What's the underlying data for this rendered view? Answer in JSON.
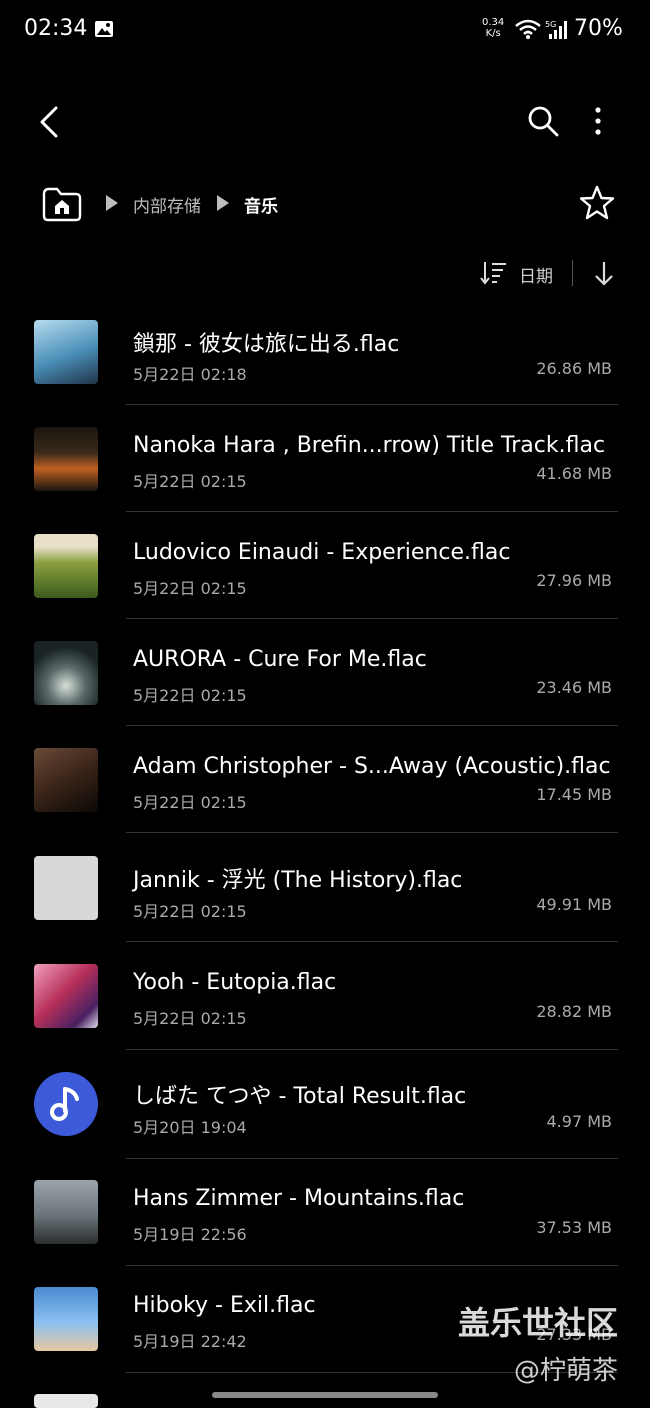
{
  "status_bar": {
    "time": "02:34",
    "net_speed_top": "0.34",
    "net_speed_bottom": "K/s",
    "signal_label": "5G",
    "battery": "70%"
  },
  "breadcrumb": {
    "items": [
      "内部存储",
      "音乐"
    ]
  },
  "sort": {
    "label": "日期"
  },
  "files": [
    {
      "name": "鎖那 - 彼女は旅に出る.flac",
      "date": "5月22日 02:18",
      "size": "26.86 MB",
      "thumb_color": "#4a8fb8"
    },
    {
      "name": "Nanoka Hara , Brefin...rrow) Title Track.flac",
      "date": "5月22日 02:15",
      "size": "41.68 MB",
      "thumb_color": "#3a2a1a"
    },
    {
      "name": "Ludovico Einaudi - Experience.flac",
      "date": "5月22日 02:15",
      "size": "27.96 MB",
      "thumb_color": "#5a7a2a"
    },
    {
      "name": "AURORA - Cure For Me.flac",
      "date": "5月22日 02:15",
      "size": "23.46 MB",
      "thumb_color": "#2a3a3a"
    },
    {
      "name": "Adam Christopher - S...Away (Acoustic).flac",
      "date": "5月22日 02:15",
      "size": "17.45 MB",
      "thumb_color": "#3a2418"
    },
    {
      "name": "Jannik - 浮光 (The History).flac",
      "date": "5月22日 02:15",
      "size": "49.91 MB",
      "thumb_color": "#d8d8d8"
    },
    {
      "name": "Yooh - Eutopia.flac",
      "date": "5月22日 02:15",
      "size": "28.82 MB",
      "thumb_color": "#b8305a"
    },
    {
      "name": "しばた てつや - Total Result.flac",
      "date": "5月20日 19:04",
      "size": "4.97 MB",
      "thumb_color": "#3d5bd8"
    },
    {
      "name": "Hans Zimmer - Mountains.flac",
      "date": "5月19日 22:56",
      "size": "37.53 MB",
      "thumb_color": "#6a747a"
    },
    {
      "name": "Hiboky - Exil.flac",
      "date": "5月19日 22:42",
      "size": "27.33 MB",
      "thumb_color": "#4a8ad0"
    }
  ],
  "watermark": {
    "line1": "盖乐世社区",
    "line2": "@柠萌茶"
  }
}
